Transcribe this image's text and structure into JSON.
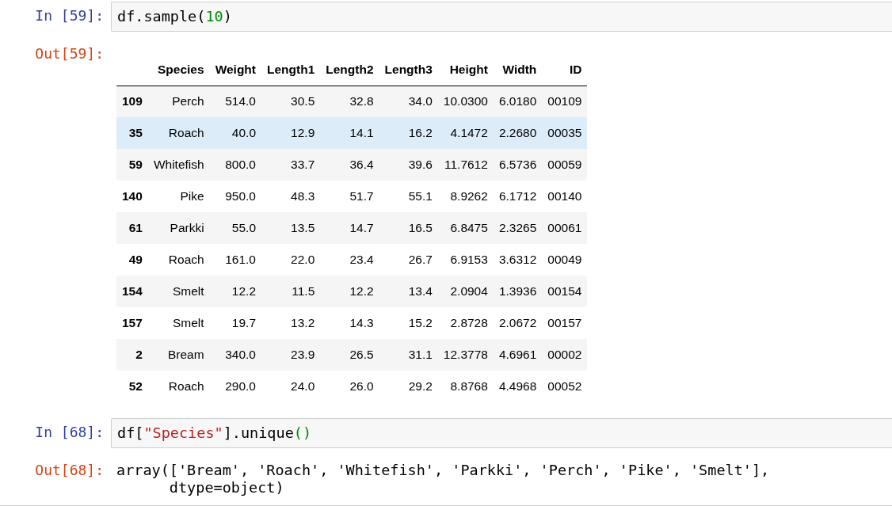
{
  "cells": [
    {
      "in_prompt": "In [59]:",
      "code": [
        {
          "text": "df.sample(",
          "kind": "plain"
        },
        {
          "text": "10",
          "kind": "number"
        },
        {
          "text": ")",
          "kind": "plain"
        }
      ],
      "out_prompt": "Out[59]:",
      "output": {
        "kind": "table",
        "columns": [
          "",
          "Species",
          "Weight",
          "Length1",
          "Length2",
          "Length3",
          "Height",
          "Width",
          "ID"
        ],
        "rows": [
          {
            "highlighted": false,
            "cells": [
              "109",
              "Perch",
              "514.0",
              "30.5",
              "32.8",
              "34.0",
              "10.0300",
              "6.0180",
              "00109"
            ]
          },
          {
            "highlighted": true,
            "cells": [
              "35",
              "Roach",
              "40.0",
              "12.9",
              "14.1",
              "16.2",
              "4.1472",
              "2.2680",
              "00035"
            ]
          },
          {
            "highlighted": false,
            "cells": [
              "59",
              "Whitefish",
              "800.0",
              "33.7",
              "36.4",
              "39.6",
              "11.7612",
              "6.5736",
              "00059"
            ]
          },
          {
            "highlighted": false,
            "cells": [
              "140",
              "Pike",
              "950.0",
              "48.3",
              "51.7",
              "55.1",
              "8.9262",
              "6.1712",
              "00140"
            ]
          },
          {
            "highlighted": false,
            "cells": [
              "61",
              "Parkki",
              "55.0",
              "13.5",
              "14.7",
              "16.5",
              "6.8475",
              "2.3265",
              "00061"
            ]
          },
          {
            "highlighted": false,
            "cells": [
              "49",
              "Roach",
              "161.0",
              "22.0",
              "23.4",
              "26.7",
              "6.9153",
              "3.6312",
              "00049"
            ]
          },
          {
            "highlighted": false,
            "cells": [
              "154",
              "Smelt",
              "12.2",
              "11.5",
              "12.2",
              "13.4",
              "2.0904",
              "1.3936",
              "00154"
            ]
          },
          {
            "highlighted": false,
            "cells": [
              "157",
              "Smelt",
              "19.7",
              "13.2",
              "14.3",
              "15.2",
              "2.8728",
              "2.0672",
              "00157"
            ]
          },
          {
            "highlighted": false,
            "cells": [
              "2",
              "Bream",
              "340.0",
              "23.9",
              "26.5",
              "31.1",
              "12.3778",
              "4.6961",
              "00002"
            ]
          },
          {
            "highlighted": false,
            "cells": [
              "52",
              "Roach",
              "290.0",
              "24.0",
              "26.0",
              "29.2",
              "8.8768",
              "4.4968",
              "00052"
            ]
          }
        ]
      }
    },
    {
      "in_prompt": "In [68]:",
      "code": [
        {
          "text": "df[",
          "kind": "plain"
        },
        {
          "text": "\"Species\"",
          "kind": "string"
        },
        {
          "text": "].unique",
          "kind": "plain"
        },
        {
          "text": "()",
          "kind": "paren"
        }
      ],
      "out_prompt": "Out[68]:",
      "output": {
        "kind": "text",
        "lines": [
          "array(['Bream', 'Roach', 'Whitefish', 'Parkki', 'Perch', 'Pike', 'Smelt'],",
          "      dtype=object)"
        ]
      }
    }
  ]
}
